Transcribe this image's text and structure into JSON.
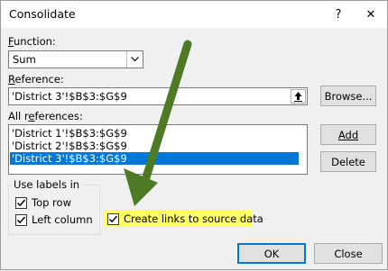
{
  "window": {
    "title": "Consolidate",
    "help_symbol": "?",
    "close_symbol": "✕"
  },
  "function": {
    "label_prefix": "",
    "label_accel": "F",
    "label_rest": "unction:",
    "selected": "Sum"
  },
  "reference": {
    "label_accel": "R",
    "label_rest": "eference:",
    "value": "'District 3'!$B$3:$G$9",
    "browse_label": "Browse..."
  },
  "all_references": {
    "label_pre": "All r",
    "label_accel": "e",
    "label_rest": "ferences:",
    "items": [
      "'District 1'!$B$3:$G$9",
      "'District 2'!$B$3:$G$9",
      "'District 3'!$B$3:$G$9"
    ],
    "selected_index": 2,
    "add_label": "Add",
    "delete_label": "Delete"
  },
  "use_labels": {
    "title": "Use labels in",
    "top_row": {
      "label": "Top row",
      "checked": true
    },
    "left_column": {
      "label": "Left column",
      "checked": true
    }
  },
  "create_links": {
    "label": "Create links to source data",
    "checked": true
  },
  "footer": {
    "ok_label": "OK",
    "close_label": "Close"
  },
  "colors": {
    "selection": "#0078d7",
    "highlight": "#ffff66",
    "arrow": "#4e7a26"
  }
}
